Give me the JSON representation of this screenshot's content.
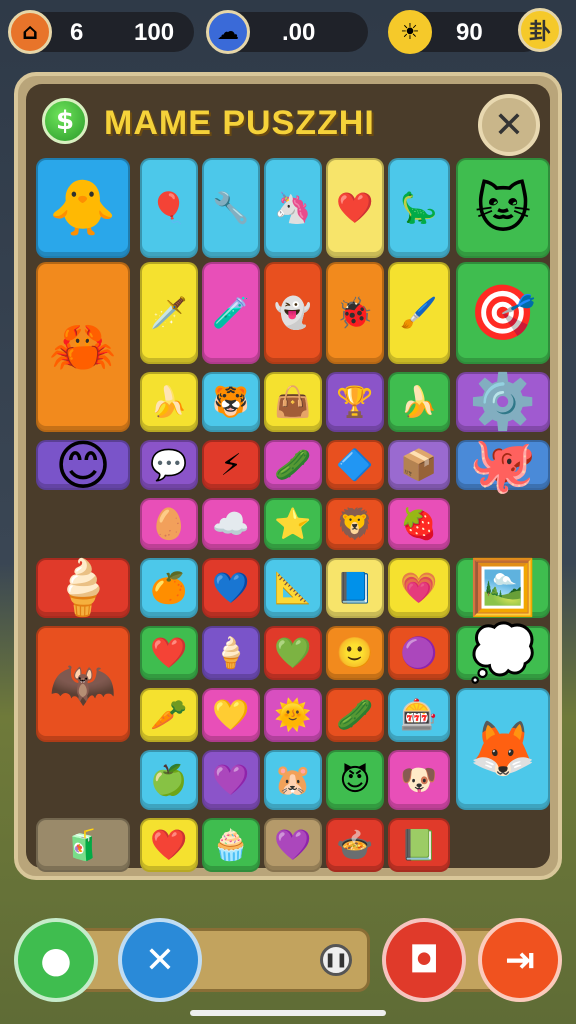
{
  "hud": {
    "left_value_a": "6",
    "left_value_b": "100",
    "center_value": ".00",
    "right_value": "90",
    "left_icon": "shop-icon",
    "center_icon": "globe-icon",
    "right_icon": "sun-icon",
    "right_button_icon": "menu-icon"
  },
  "panel": {
    "title": "MAME PUSZZHI",
    "badge_symbol": "$",
    "close_symbol": "✕"
  },
  "tiles": [
    {
      "c": "#2aa7ea",
      "g": "🐥",
      "big": true,
      "col": 0,
      "row": 0,
      "w": 1,
      "h": 1
    },
    {
      "c": "#4cc8ea",
      "g": "🎈",
      "col": 1,
      "row": 0
    },
    {
      "c": "#4cc8ea",
      "g": "🔧",
      "col": 2,
      "row": 0
    },
    {
      "c": "#4cc8ea",
      "g": "🦄",
      "col": 3,
      "row": 0
    },
    {
      "c": "#f7e46a",
      "g": "❤️",
      "col": 4,
      "row": 0
    },
    {
      "c": "#4cc8ea",
      "g": "🦕",
      "col": 5,
      "row": 0
    },
    {
      "c": "#3fbd4f",
      "g": "🐱",
      "big": true,
      "col": 6,
      "row": 0
    },
    {
      "c": "#f28a1d",
      "g": "🦀",
      "big": true,
      "col": 0,
      "row": 1,
      "h": 2
    },
    {
      "c": "#f5e12f",
      "g": "🗡️",
      "col": 1,
      "row": 1
    },
    {
      "c": "#e84fb8",
      "g": "🧪",
      "col": 2,
      "row": 1
    },
    {
      "c": "#e8501f",
      "g": "👻",
      "col": 3,
      "row": 1
    },
    {
      "c": "#f28a1d",
      "g": "🐞",
      "col": 4,
      "row": 1
    },
    {
      "c": "#f5e12f",
      "g": "🖌️",
      "col": 5,
      "row": 1
    },
    {
      "c": "#3fbd4f",
      "g": "🎯",
      "big": true,
      "col": 6,
      "row": 1
    },
    {
      "c": "#f5e12f",
      "g": "🍌",
      "col": 1,
      "row": 2
    },
    {
      "c": "#4cc8ea",
      "g": "🐯",
      "col": 2,
      "row": 2
    },
    {
      "c": "#f5e12f",
      "g": "👜",
      "col": 3,
      "row": 2
    },
    {
      "c": "#8b54c9",
      "g": "🏆",
      "col": 4,
      "row": 2
    },
    {
      "c": "#3fbd4f",
      "g": "🍌",
      "col": 5,
      "row": 2
    },
    {
      "c": "#a05ad0",
      "g": "⚙️",
      "big": true,
      "col": 6,
      "row": 2
    },
    {
      "c": "#7a54c9",
      "g": "😊",
      "big": true,
      "col": 0,
      "row": 3
    },
    {
      "c": "#8b54c9",
      "g": "💬",
      "col": 1,
      "row": 3
    },
    {
      "c": "#e03a2a",
      "g": "⚡",
      "col": 2,
      "row": 3
    },
    {
      "c": "#d84fc0",
      "g": "🥒",
      "col": 3,
      "row": 3
    },
    {
      "c": "#e8501f",
      "g": "🔷",
      "col": 4,
      "row": 3
    },
    {
      "c": "#9a6ad0",
      "g": "📦",
      "col": 5,
      "row": 3
    },
    {
      "c": "#4a8ad8",
      "g": "🐙",
      "big": true,
      "col": 6,
      "row": 3
    },
    {
      "c": "#e84fb8",
      "g": "🥚",
      "col": 1,
      "row": 4
    },
    {
      "c": "#e84fb8",
      "g": "☁️",
      "col": 2,
      "row": 4
    },
    {
      "c": "#3fbd4f",
      "g": "⭐",
      "col": 3,
      "row": 4
    },
    {
      "c": "#e8501f",
      "g": "🦁",
      "col": 4,
      "row": 4
    },
    {
      "c": "#e84fb8",
      "g": "🍓",
      "col": 5,
      "row": 4
    },
    {
      "c": "#e03a2a",
      "g": "🍦",
      "big": true,
      "col": 0,
      "row": 5
    },
    {
      "c": "#4cc8ea",
      "g": "🍊",
      "col": 1,
      "row": 5
    },
    {
      "c": "#e03a2a",
      "g": "💙",
      "col": 2,
      "row": 5
    },
    {
      "c": "#4cc8ea",
      "g": "📐",
      "col": 3,
      "row": 5
    },
    {
      "c": "#f7e46a",
      "g": "📘",
      "col": 4,
      "row": 5
    },
    {
      "c": "#f5e12f",
      "g": "💗",
      "col": 5,
      "row": 5
    },
    {
      "c": "#3fbd4f",
      "g": "🖼️",
      "big": true,
      "col": 6,
      "row": 5
    },
    {
      "c": "#e8501f",
      "g": "🦇",
      "big": true,
      "col": 0,
      "row": 6,
      "h": 2
    },
    {
      "c": "#3fbd4f",
      "g": "❤️",
      "col": 1,
      "row": 6
    },
    {
      "c": "#7a54c9",
      "g": "🍦",
      "col": 2,
      "row": 6
    },
    {
      "c": "#e03a2a",
      "g": "💚",
      "col": 3,
      "row": 6
    },
    {
      "c": "#f28a1d",
      "g": "🙂",
      "col": 4,
      "row": 6
    },
    {
      "c": "#e8501f",
      "g": "🟣",
      "col": 5,
      "row": 6
    },
    {
      "c": "#3fbd4f",
      "g": "💭",
      "big": true,
      "col": 6,
      "row": 6
    },
    {
      "c": "#f5e12f",
      "g": "🥕",
      "col": 1,
      "row": 7
    },
    {
      "c": "#e84fb8",
      "g": "💛",
      "col": 2,
      "row": 7
    },
    {
      "c": "#d84fc0",
      "g": "🌞",
      "col": 3,
      "row": 7
    },
    {
      "c": "#e8501f",
      "g": "🥒",
      "col": 4,
      "row": 7
    },
    {
      "c": "#4cc8ea",
      "g": "🎰",
      "col": 5,
      "row": 7
    },
    {
      "c": "#4cc8ea",
      "g": "🦊",
      "big": true,
      "col": 6,
      "row": 7,
      "h": 2
    },
    {
      "c": "#4cc8ea",
      "g": "🍏",
      "col": 1,
      "row": 8
    },
    {
      "c": "#8b54c9",
      "g": "💜",
      "col": 2,
      "row": 8
    },
    {
      "c": "#4cc8ea",
      "g": "🐹",
      "col": 3,
      "row": 8
    },
    {
      "c": "#3fbd4f",
      "g": "😈",
      "col": 4,
      "row": 8
    },
    {
      "c": "#e84fb8",
      "g": "🐶",
      "col": 5,
      "row": 8
    },
    {
      "c": "#9a8a6a",
      "g": "🧃",
      "col": 0,
      "row": 9
    },
    {
      "c": "#f5e12f",
      "g": "❤️",
      "col": 1,
      "row": 9
    },
    {
      "c": "#3fbd4f",
      "g": "🧁",
      "col": 2,
      "row": 9
    },
    {
      "c": "#b59a6a",
      "g": "💜",
      "col": 3,
      "row": 9
    },
    {
      "c": "#e03a2a",
      "g": "🍲",
      "col": 4,
      "row": 9
    },
    {
      "c": "#e03a2a",
      "g": "📗",
      "col": 5,
      "row": 9
    }
  ],
  "controls": {
    "left_btn_icon": "joystick-icon",
    "shuffle_btn_icon": "shuffle-icon",
    "pause_icon": "pause-icon",
    "camera_btn_icon": "camera-icon",
    "exit_btn_icon": "exit-icon"
  },
  "colors": {
    "accent_title": "#f5d23a",
    "panel_bg": "#4a3c2a",
    "green_btn": "#3fbd4f",
    "blue_btn": "#2a8ad8",
    "red_btn": "#e03a2a"
  }
}
